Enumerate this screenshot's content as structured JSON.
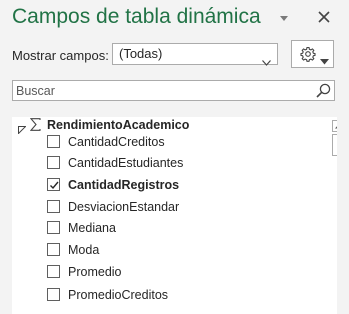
{
  "pane": {
    "title": "Campos de tabla dinámica",
    "menu_icon": "pane-options-down-triangle",
    "close_icon": "close-x"
  },
  "show_fields": {
    "label": "Mostrar campos:",
    "selected": "(Todas)"
  },
  "tools": {
    "icon": "gear-icon"
  },
  "search": {
    "placeholder": "Buscar",
    "value": ""
  },
  "field_list": {
    "table_name": "RendimientoAcademico",
    "table_icon": "sigma-icon",
    "fields": [
      {
        "label": "CantidadCreditos",
        "checked": false
      },
      {
        "label": "CantidadEstudiantes",
        "checked": false
      },
      {
        "label": "CantidadRegistros",
        "checked": true
      },
      {
        "label": "DesviacionEstandar",
        "checked": false
      },
      {
        "label": "Mediana",
        "checked": false
      },
      {
        "label": "Moda",
        "checked": false
      },
      {
        "label": "Promedio",
        "checked": false
      },
      {
        "label": "PromedioCreditos",
        "checked": false
      }
    ]
  },
  "colors": {
    "title": "#217346",
    "pane_bg": "#f3f3f3",
    "list_bg": "#ffffff",
    "border": "#ababab"
  }
}
